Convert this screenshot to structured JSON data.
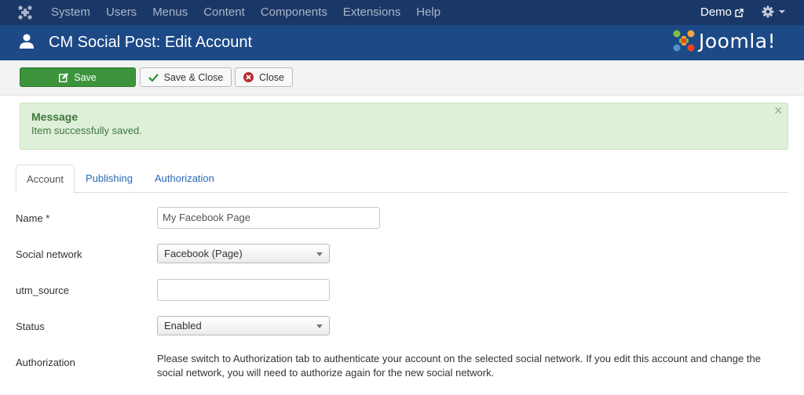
{
  "nav": {
    "menu": [
      "System",
      "Users",
      "Menus",
      "Content",
      "Components",
      "Extensions",
      "Help"
    ],
    "user_label": "Demo"
  },
  "header": {
    "title": "CM Social Post: Edit Account",
    "brand": "Joomla!"
  },
  "toolbar": {
    "save_label": "Save",
    "save_close_label": "Save & Close",
    "close_label": "Close"
  },
  "message": {
    "heading": "Message",
    "text": "Item successfully saved.",
    "close": "×"
  },
  "tabs": [
    "Account",
    "Publishing",
    "Authorization"
  ],
  "form": {
    "name_label": "Name *",
    "name_value": "My Facebook Page",
    "network_label": "Social network",
    "network_value": "Facebook (Page)",
    "utm_label": "utm_source",
    "utm_value": "",
    "status_label": "Status",
    "status_value": "Enabled",
    "auth_label": "Authorization",
    "auth_text": "Please switch to Authorization tab to authenticate your account on the selected social network. If you edit this account and change the social network, you will need to authorize again for the new social network."
  },
  "colors": {
    "navbar": "#1a3867",
    "header": "#1d4987",
    "save_button": "#3b943b",
    "alert_bg": "#dff0d8",
    "alert_text": "#3c763d",
    "link": "#2a69b8"
  }
}
